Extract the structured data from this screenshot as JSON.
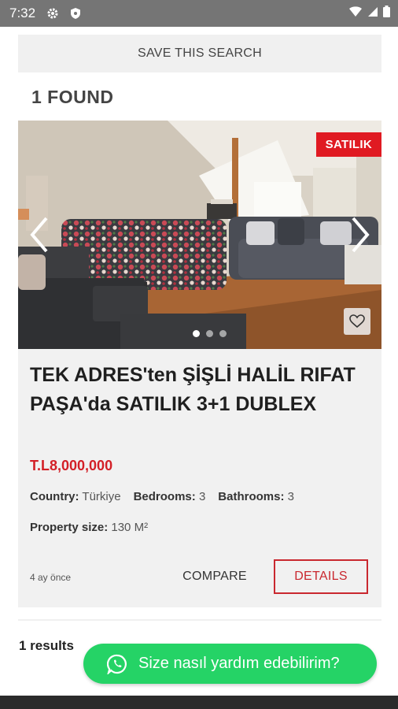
{
  "status_bar": {
    "time": "7:32"
  },
  "search": {
    "save_label": "SAVE THIS SEARCH",
    "found_label": "1 FOUND"
  },
  "listing": {
    "badge": "SATILIK",
    "title": "TEK ADRES'ten ŞİŞLİ HALİL RIFAT PAŞA'da SATILIK 3+1 DUBLEX",
    "price": "T.L8,000,000",
    "country_label": "Country:",
    "country_value": "Türkiye",
    "bedrooms_label": "Bedrooms:",
    "bedrooms_value": "3",
    "bathrooms_label": "Bathrooms:",
    "bathrooms_value": "3",
    "size_label": "Property size:",
    "size_value": "130 M²",
    "posted": "4 ay önce",
    "compare_label": "COMPARE",
    "details_label": "DETAILS",
    "carousel": {
      "total": 3,
      "active": 1
    }
  },
  "footer": {
    "results": "1 results"
  },
  "whatsapp": {
    "label": "Size nasıl yardım edebilirim?",
    "color": "#25d366"
  },
  "colors": {
    "accent": "#d32027",
    "status_bar": "#757575"
  }
}
